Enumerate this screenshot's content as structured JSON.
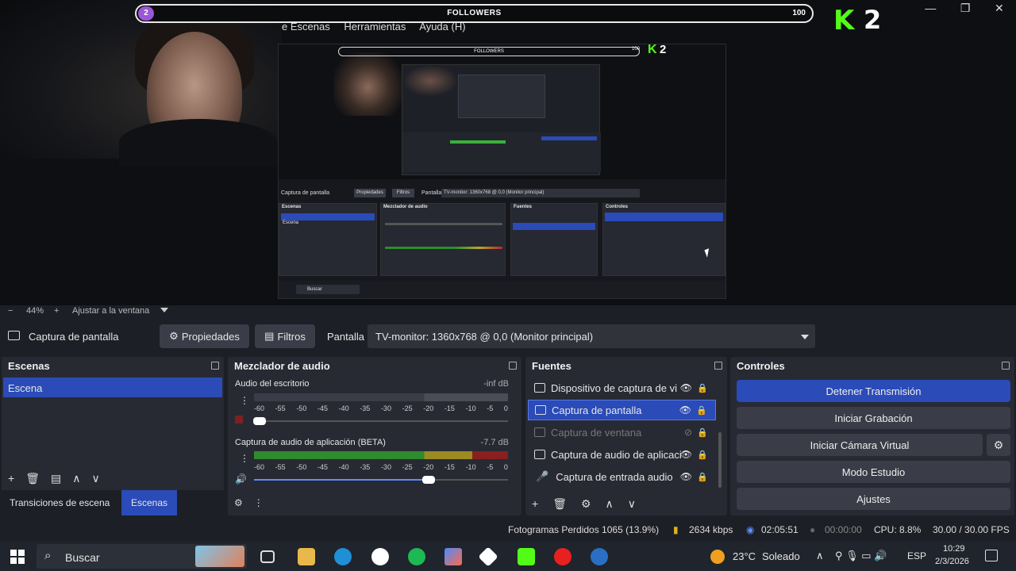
{
  "overlay": {
    "followers_badge": "2",
    "followers_label": "FOLLOWERS",
    "followers_count": "100",
    "brand_letter": "K",
    "brand_number": "2"
  },
  "menu": [
    "e Escenas",
    "Herramientas",
    "Ayuda (H)"
  ],
  "window_controls": {
    "minimize": "—",
    "maximize": "❐",
    "close": "✕"
  },
  "preview_mini": {
    "followers_label": "FOLLOWERS",
    "followers_count": "100",
    "source_label": "Captura de pantalla",
    "props": "Propiedades",
    "filters": "Filtros",
    "screen": "Pantalla",
    "monitor": "TV-monitor: 1360x768 @ 0,0 (Monitor principal)",
    "panels": [
      "Escenas",
      "Mezclador de audio",
      "Fuentes",
      "Controles"
    ],
    "scene": "Escena",
    "search": "Buscar"
  },
  "zoom": {
    "minus": "−",
    "level": "44%",
    "plus": "+",
    "fit": "Ajustar a la ventana"
  },
  "source_bar": {
    "source_name": "Captura de pantalla",
    "properties": "Propiedades",
    "filters": "Filtros",
    "screen_label": "Pantalla",
    "monitor_value": "TV-monitor: 1360x768 @ 0,0 (Monitor principal)"
  },
  "scenes": {
    "title": "Escenas",
    "items": [
      "Escena"
    ],
    "tab_transitions": "Transiciones de escena",
    "tab_scenes": "Escenas"
  },
  "mixer": {
    "title": "Mezclador de audio",
    "tracks": [
      {
        "name": "Audio del escritorio",
        "level": "-inf dB",
        "volume": 0.03
      },
      {
        "name": "Captura de audio de aplicación (BETA)",
        "level": "-7.7 dB",
        "volume": 0.7
      }
    ],
    "ticks": [
      "-60",
      "-55",
      "-50",
      "-45",
      "-40",
      "-35",
      "-30",
      "-25",
      "-20",
      "-15",
      "-10",
      "-5",
      "0"
    ]
  },
  "sources": {
    "title": "Fuentes",
    "items": [
      {
        "name": "Dispositivo de captura de vi",
        "visible": true
      },
      {
        "name": "Captura de pantalla",
        "visible": true
      },
      {
        "name": "Captura de ventana",
        "visible": false
      },
      {
        "name": "Captura de audio de aplicaci",
        "visible": true
      },
      {
        "name": "Captura de entrada audio",
        "visible": true
      }
    ]
  },
  "controls": {
    "title": "Controles",
    "stop_stream": "Detener Transmisión",
    "start_recording": "Iniciar Grabación",
    "start_virtual_cam": "Iniciar Cámara Virtual",
    "studio_mode": "Modo Estudio",
    "settings": "Ajustes"
  },
  "status": {
    "dropped_frames": "Fotogramas Perdidos 1065 (13.9%)",
    "bitrate": "2634 kbps",
    "stream_time": "02:05:51",
    "rec_time": "00:00:00",
    "cpu": "CPU: 8.8%",
    "fps": "30.00 / 30.00 FPS"
  },
  "taskbar": {
    "search_placeholder": "Buscar",
    "weather_temp": "23°C",
    "weather_desc": "Soleado",
    "lang": "ESP",
    "time": "10:29",
    "date": "2/3/2026"
  },
  "colors": {
    "accent_blue": "#2a4bb8",
    "kick_green": "#53fc18",
    "panel_bg": "#272a33"
  }
}
